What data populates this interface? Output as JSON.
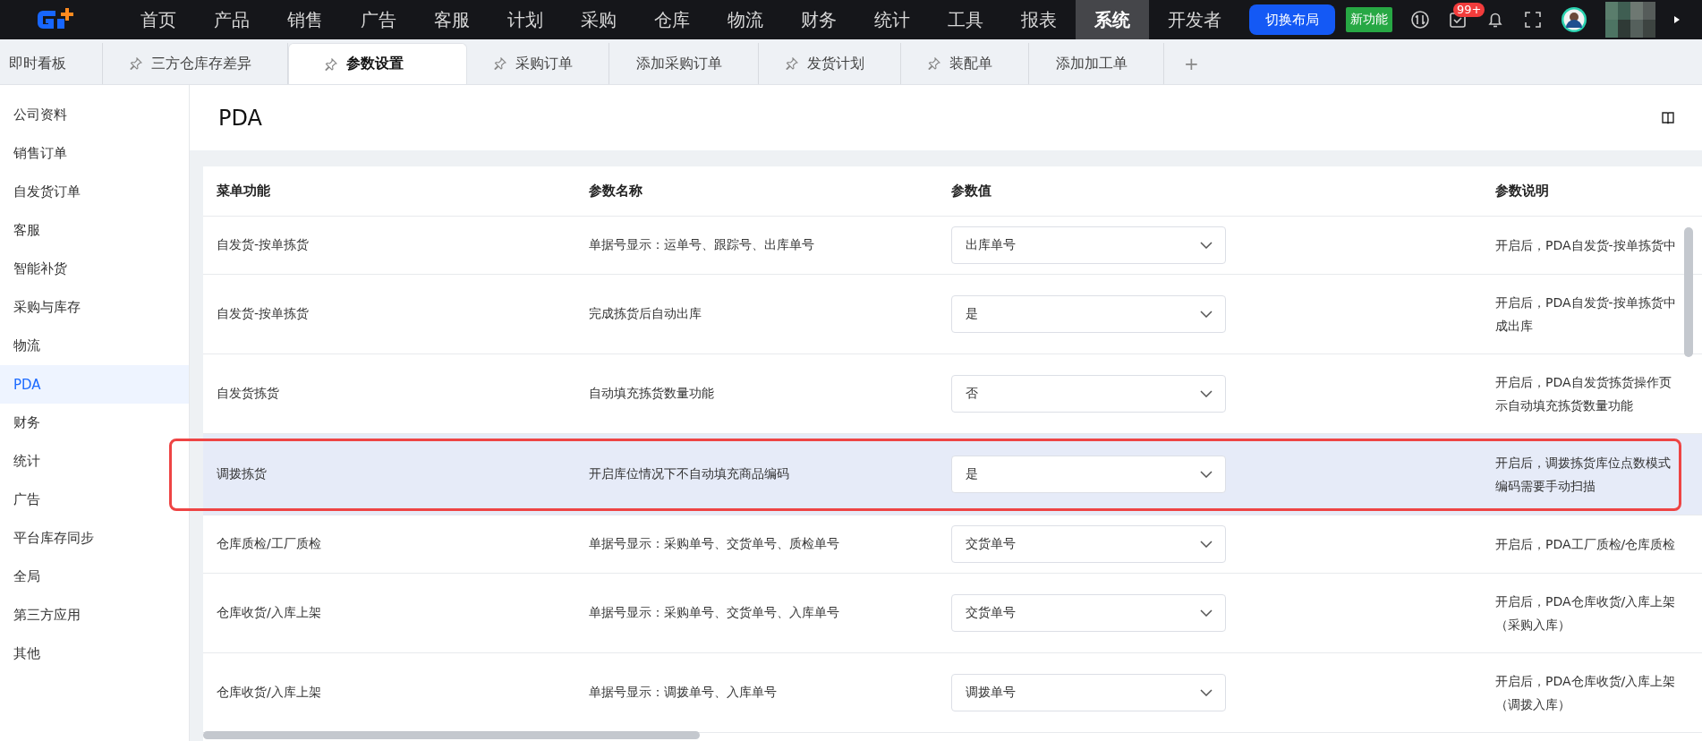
{
  "top_nav": {
    "items": [
      {
        "label": "首页",
        "selected": false
      },
      {
        "label": "产品",
        "selected": false
      },
      {
        "label": "销售",
        "selected": false
      },
      {
        "label": "广告",
        "selected": false
      },
      {
        "label": "客服",
        "selected": false
      },
      {
        "label": "计划",
        "selected": false
      },
      {
        "label": "采购",
        "selected": false
      },
      {
        "label": "仓库",
        "selected": false
      },
      {
        "label": "物流",
        "selected": false
      },
      {
        "label": "财务",
        "selected": false
      },
      {
        "label": "统计",
        "selected": false
      },
      {
        "label": "工具",
        "selected": false
      },
      {
        "label": "报表",
        "selected": false
      },
      {
        "label": "系统",
        "selected": true
      },
      {
        "label": "开发者",
        "selected": false
      }
    ],
    "switch_layout_button": "切换布局",
    "new_feature_badge": "新功能",
    "task_count": "99+"
  },
  "tabs": [
    {
      "label": "即时看板",
      "pinned": false,
      "selected": false
    },
    {
      "label": "三方仓库存差异",
      "pinned": true,
      "selected": false
    },
    {
      "label": "参数设置",
      "pinned": true,
      "selected": true
    },
    {
      "label": "采购订单",
      "pinned": true,
      "selected": false
    },
    {
      "label": "添加采购订单",
      "pinned": false,
      "selected": false
    },
    {
      "label": "发货计划",
      "pinned": true,
      "selected": false
    },
    {
      "label": "装配单",
      "pinned": true,
      "selected": false
    },
    {
      "label": "添加加工单",
      "pinned": false,
      "selected": false
    }
  ],
  "add_tab": "+",
  "sidebar": {
    "items": [
      {
        "label": "公司资料",
        "selected": false
      },
      {
        "label": "销售订单",
        "selected": false
      },
      {
        "label": "自发货订单",
        "selected": false
      },
      {
        "label": "客服",
        "selected": false
      },
      {
        "label": "智能补货",
        "selected": false
      },
      {
        "label": "采购与库存",
        "selected": false
      },
      {
        "label": "物流",
        "selected": false
      },
      {
        "label": "PDA",
        "selected": true
      },
      {
        "label": "财务",
        "selected": false
      },
      {
        "label": "统计",
        "selected": false
      },
      {
        "label": "广告",
        "selected": false
      },
      {
        "label": "平台库存同步",
        "selected": false
      },
      {
        "label": "全局",
        "selected": false
      },
      {
        "label": "第三方应用",
        "selected": false
      },
      {
        "label": "其他",
        "selected": false
      }
    ]
  },
  "page": {
    "title": "PDA"
  },
  "table": {
    "columns": [
      "菜单功能",
      "参数名称",
      "参数值",
      "参数说明"
    ],
    "rows": [
      {
        "menu_function": "自发货-按单拣货",
        "param_name": "单据号显示：运单号、跟踪号、出库单号",
        "value": "出库单号",
        "description": [
          "开启后，PDA自发货-按单拣货中"
        ],
        "highlighted": false,
        "annotated": false
      },
      {
        "menu_function": "自发货-按单拣货",
        "param_name": "完成拣货后自动出库",
        "value": "是",
        "description": [
          "开启后，PDA自发货-按单拣货中",
          "成出库"
        ],
        "highlighted": false,
        "annotated": false
      },
      {
        "menu_function": "自发货拣货",
        "param_name": "自动填充拣货数量功能",
        "value": "否",
        "description": [
          "开启后，PDA自发货拣货操作页",
          "示自动填充拣货数量功能"
        ],
        "highlighted": false,
        "annotated": false
      },
      {
        "menu_function": "调拨拣货",
        "param_name": "开启库位情况下不自动填充商品编码",
        "value": "是",
        "description": [
          "开启后，调拨拣货库位点数模式",
          "编码需要手动扫描"
        ],
        "highlighted": true,
        "annotated": true
      },
      {
        "menu_function": "仓库质检/工厂质检",
        "param_name": "单据号显示：采购单号、交货单号、质检单号",
        "value": "交货单号",
        "description": [
          "开启后，PDA工厂质检/仓库质检"
        ],
        "highlighted": false,
        "annotated": false
      },
      {
        "menu_function": "仓库收货/入库上架",
        "param_name": "单据号显示：采购单号、交货单号、入库单号",
        "value": "交货单号",
        "description": [
          "开启后，PDA仓库收货/入库上架",
          "（采购入库）"
        ],
        "highlighted": false,
        "annotated": false
      },
      {
        "menu_function": "仓库收货/入库上架",
        "param_name": "单据号显示：调拨单号、入库单号",
        "value": "调拨单号",
        "description": [
          "开启后，PDA仓库收货/入库上架",
          "（调拨入库）"
        ],
        "highlighted": false,
        "annotated": false
      }
    ]
  }
}
